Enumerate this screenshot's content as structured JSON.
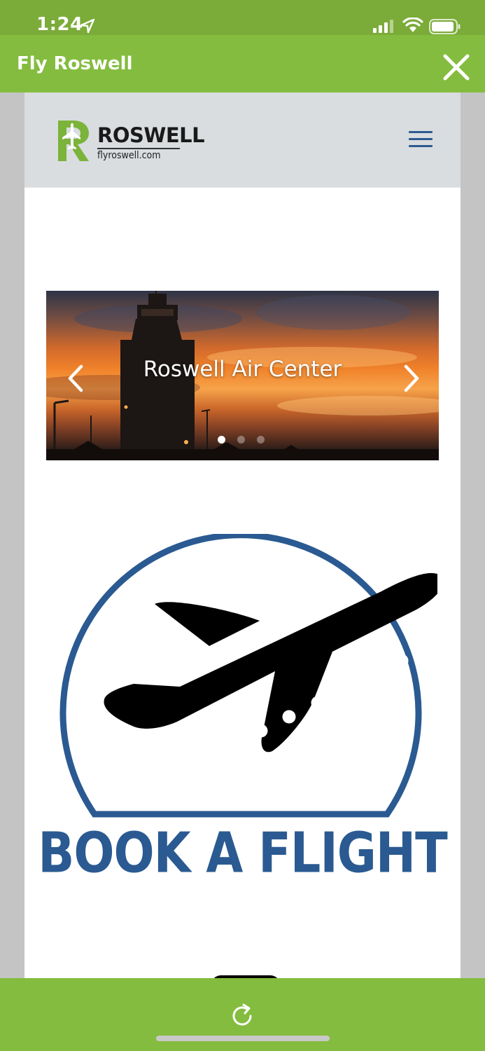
{
  "status_bar": {
    "time": "1:24"
  },
  "app_header": {
    "title": "Fly Roswell"
  },
  "site": {
    "logo_name": "ROSWELL",
    "logo_url": "flyroswell.com"
  },
  "slider": {
    "caption": "Roswell Air Center",
    "slide_count": 3,
    "active_slide": 1
  },
  "book_flight": {
    "label": "BOOK A FLIGHT"
  },
  "colors": {
    "app_green": "#84bc3f",
    "brand_blue": "#2a5a91",
    "next_tile_teal": "#6a9aa0"
  }
}
